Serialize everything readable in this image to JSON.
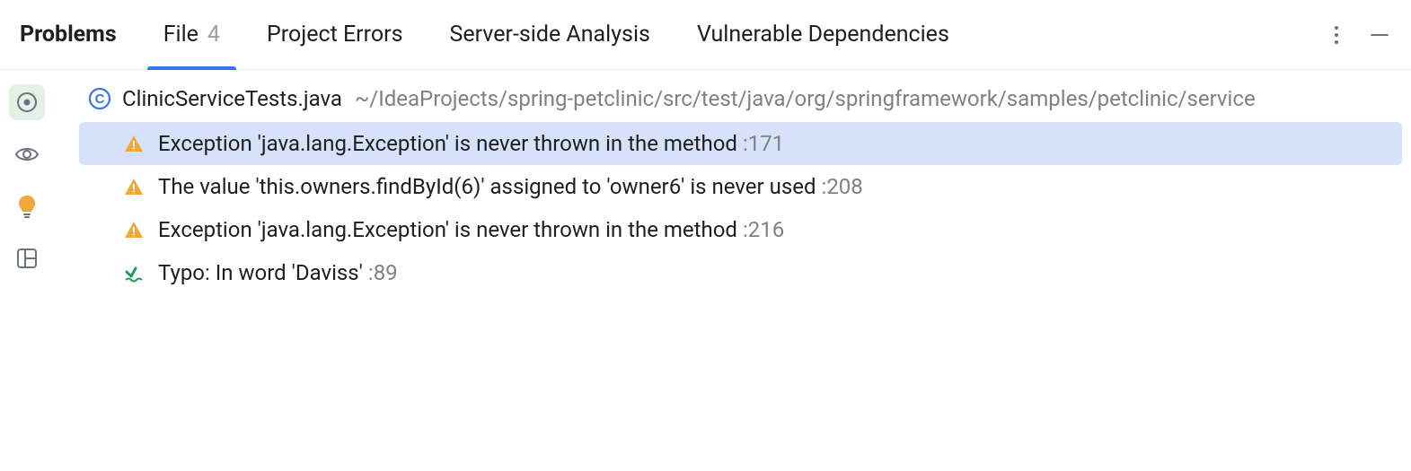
{
  "tabs": {
    "title": "Problems",
    "file": {
      "label": "File",
      "count": "4"
    },
    "project_errors": "Project Errors",
    "server_side": "Server-side Analysis",
    "vuln_deps": "Vulnerable Dependencies"
  },
  "file": {
    "name": "ClinicServiceTests.java",
    "path": "~/IdeaProjects/spring-petclinic/src/test/java/org/springframework/samples/petclinic/service"
  },
  "issues": [
    {
      "severity": "warning",
      "message": "Exception 'java.lang.Exception' is never thrown in the method",
      "loc": ":171",
      "selected": true
    },
    {
      "severity": "warning",
      "message": "The value 'this.owners.findById(6)' assigned to 'owner6' is never used",
      "loc": ":208",
      "selected": false
    },
    {
      "severity": "warning",
      "message": "Exception 'java.lang.Exception' is never thrown in the method",
      "loc": ":216",
      "selected": false
    },
    {
      "severity": "typo",
      "message": "Typo: In word 'Daviss'",
      "loc": ":89",
      "selected": false
    }
  ]
}
